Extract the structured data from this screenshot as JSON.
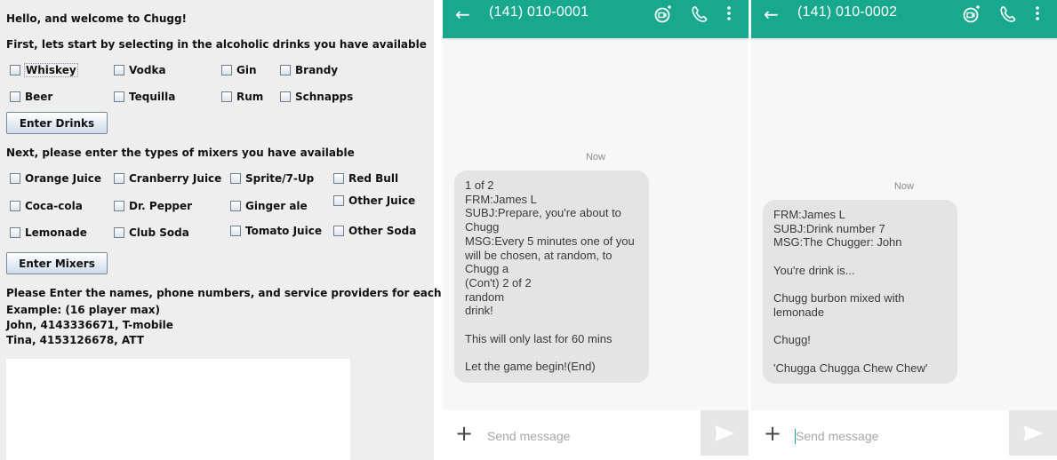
{
  "form": {
    "greeting": "Hello, and welcome to Chugg!",
    "drinks_prompt": "First, lets start by selecting in the alcoholic drinks you have available",
    "drinks": [
      "Whiskey",
      "Vodka",
      "Gin",
      "Brandy",
      "Beer",
      "Tequilla",
      "Rum",
      "Schnapps"
    ],
    "enter_drinks_label": "Enter Drinks",
    "mixers_prompt": "Next, please enter the types of mixers you have available",
    "mixers": [
      "Orange Juice",
      "Cranberry Juice",
      "Sprite/7-Up",
      "Red Bull",
      "Coca-cola",
      "Dr. Pepper",
      "Ginger ale",
      "Other Juice",
      "Lemonade",
      "Club Soda",
      "Tomato Juice",
      "Other Soda"
    ],
    "enter_mixers_label": "Enter Mixers",
    "players_prompt": "Please Enter the names, phone numbers, and service providers for each player.",
    "example_line": "Example:   (16 player max)",
    "example_1": "John, 4143336671, T-mobile",
    "example_2": "Tina, 4153126678, ATT",
    "players_text": ""
  },
  "colors": {
    "app_bar": "#18a88e",
    "bubble": "#e4e4e4",
    "form_bg": "#eeeeee"
  },
  "chats": [
    {
      "contact": "(141) 010-0001",
      "timestamp": "Now",
      "lines": [
        "1 of 2",
        "FRM:James L",
        "SUBJ:Prepare, you're about to",
        "Chugg",
        "MSG:Every 5 minutes one of you",
        "will be chosen, at random, to",
        "Chugg a",
        "(Con't) 2 of 2",
        "random",
        "drink!",
        "",
        "This will only last for 60 mins",
        "",
        "Let the game begin!(End)"
      ],
      "input_placeholder": "Send message",
      "icons": [
        "back-arrow-icon",
        "video-call-icon",
        "phone-icon",
        "more-vert-icon",
        "add-icon",
        "send-icon"
      ]
    },
    {
      "contact": "(141) 010-0002",
      "timestamp": "Now",
      "lines": [
        "FRM:James L",
        "SUBJ:Drink number 7",
        "MSG:The Chugger: John",
        "",
        "You're drink is...",
        "",
        "Chugg burbon mixed with",
        "lemonade",
        "",
        "Chugg!",
        "",
        "'Chugga Chugga Chew Chew'"
      ],
      "input_placeholder": "Send message",
      "icons": [
        "back-arrow-icon",
        "video-call-icon",
        "phone-icon",
        "more-vert-icon",
        "add-icon",
        "send-icon"
      ]
    }
  ]
}
